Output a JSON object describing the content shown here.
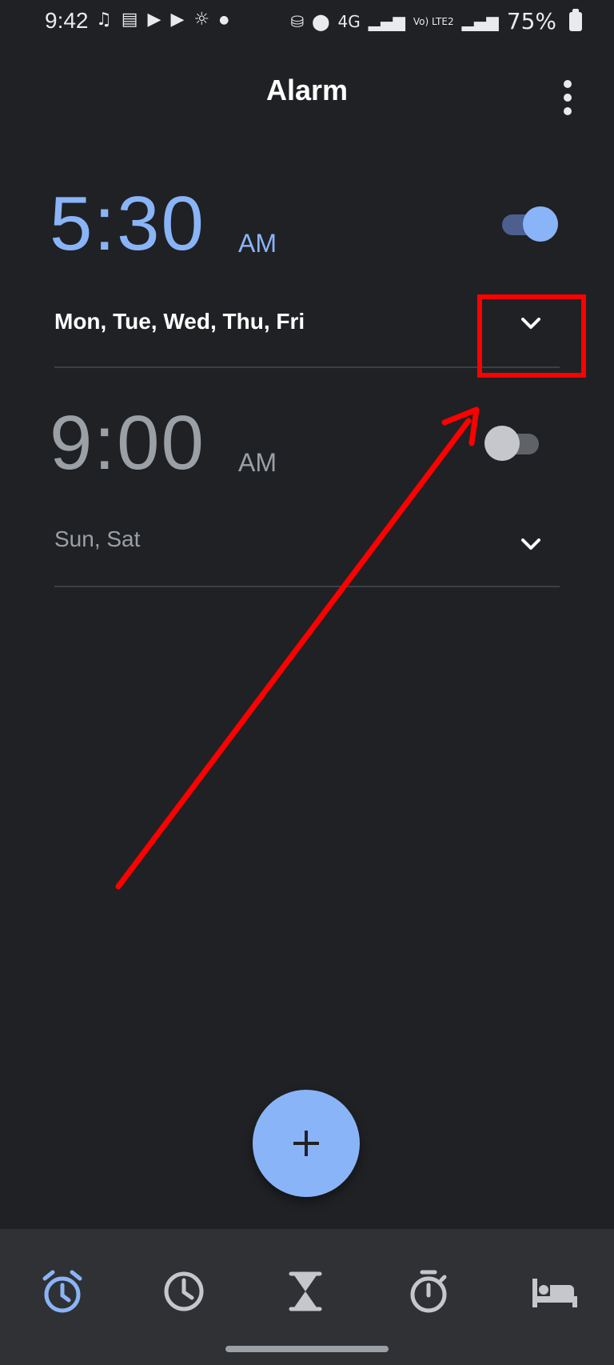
{
  "status_bar": {
    "time": "9:42",
    "network_4g": "4G",
    "volte": "Vo) LTE2",
    "battery": "75%"
  },
  "app_bar": {
    "title": "Alarm"
  },
  "alarms": [
    {
      "time": "5:30",
      "ampm": "AM",
      "days": "Mon, Tue, Wed, Thu, Fri",
      "enabled": true
    },
    {
      "time": "9:00",
      "ampm": "AM",
      "days": "Sun, Sat",
      "enabled": false
    }
  ],
  "fab": {
    "icon": "plus-icon"
  },
  "bottom_nav": {
    "items": [
      {
        "icon": "alarm-icon",
        "selected": true
      },
      {
        "icon": "clock-icon",
        "selected": false
      },
      {
        "icon": "timer-icon",
        "selected": false
      },
      {
        "icon": "stopwatch-icon",
        "selected": false
      },
      {
        "icon": "bedtime-icon",
        "selected": false
      }
    ]
  },
  "colors": {
    "background": "#202124",
    "accent": "#8ab4f8",
    "annotation": "#ff0000",
    "nav_background": "#303134"
  }
}
